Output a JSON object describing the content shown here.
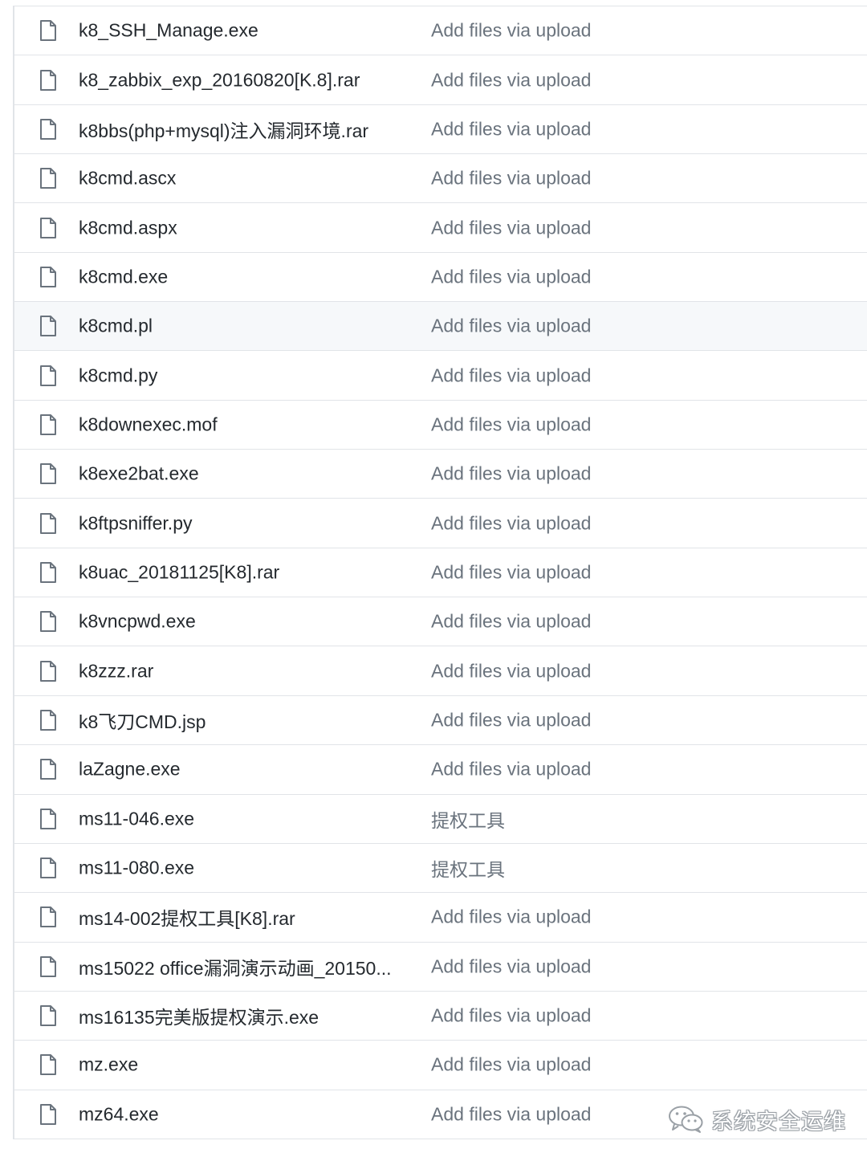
{
  "colors": {
    "file_name": "#24292e",
    "commit_message": "#6a737d",
    "row_border": "#e1e4e8",
    "row_highlight": "#f6f8fa",
    "icon_stroke": "#6a737d"
  },
  "files": [
    {
      "name": "k8_SSH_Manage.exe",
      "message": "Add files via upload",
      "icon": "file-icon"
    },
    {
      "name": "k8_zabbix_exp_20160820[K.8].rar",
      "message": "Add files via upload",
      "icon": "file-icon"
    },
    {
      "name": "k8bbs(php+mysql)注入漏洞环境.rar",
      "message": "Add files via upload",
      "icon": "file-icon"
    },
    {
      "name": "k8cmd.ascx",
      "message": "Add files via upload",
      "icon": "file-icon"
    },
    {
      "name": "k8cmd.aspx",
      "message": "Add files via upload",
      "icon": "file-icon"
    },
    {
      "name": "k8cmd.exe",
      "message": "Add files via upload",
      "icon": "file-icon"
    },
    {
      "name": "k8cmd.pl",
      "message": "Add files via upload",
      "icon": "file-icon",
      "highlighted": true
    },
    {
      "name": "k8cmd.py",
      "message": "Add files via upload",
      "icon": "file-icon"
    },
    {
      "name": "k8downexec.mof",
      "message": "Add files via upload",
      "icon": "file-icon"
    },
    {
      "name": "k8exe2bat.exe",
      "message": "Add files via upload",
      "icon": "file-icon"
    },
    {
      "name": "k8ftpsniffer.py",
      "message": "Add files via upload",
      "icon": "file-icon"
    },
    {
      "name": "k8uac_20181125[K8].rar",
      "message": "Add files via upload",
      "icon": "file-icon"
    },
    {
      "name": "k8vncpwd.exe",
      "message": "Add files via upload",
      "icon": "file-icon"
    },
    {
      "name": "k8zzz.rar",
      "message": "Add files via upload",
      "icon": "file-icon"
    },
    {
      "name": "k8飞刀CMD.jsp",
      "message": "Add files via upload",
      "icon": "file-icon"
    },
    {
      "name": "laZagne.exe",
      "message": "Add files via upload",
      "icon": "file-icon"
    },
    {
      "name": "ms11-046.exe",
      "message": "提权工具",
      "icon": "file-icon"
    },
    {
      "name": "ms11-080.exe",
      "message": "提权工具",
      "icon": "file-icon"
    },
    {
      "name": "ms14-002提权工具[K8].rar",
      "message": "Add files via upload",
      "icon": "file-icon"
    },
    {
      "name": "ms15022 office漏洞演示动画_20150...",
      "message": "Add files via upload",
      "icon": "file-icon"
    },
    {
      "name": "ms16135完美版提权演示.exe",
      "message": "Add files via upload",
      "icon": "file-icon"
    },
    {
      "name": "mz.exe",
      "message": "Add files via upload",
      "icon": "file-icon"
    },
    {
      "name": "mz64.exe",
      "message": "Add files via upload",
      "icon": "file-icon"
    }
  ],
  "watermark": {
    "icon": "wechat-icon",
    "text": "系统安全运维"
  }
}
